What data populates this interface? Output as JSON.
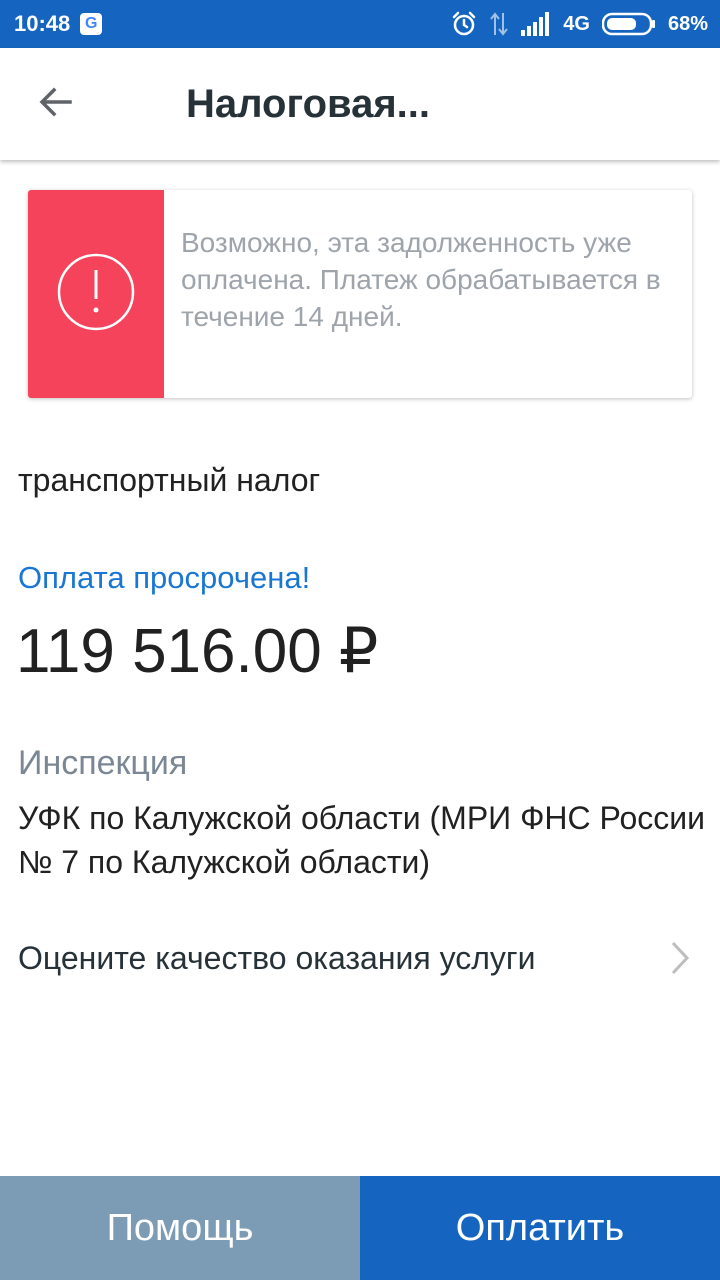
{
  "status_bar": {
    "time": "10:48",
    "google_badge": "G",
    "network": "4G",
    "battery": "68%",
    "icons": [
      "alarm-icon",
      "data-arrows-icon",
      "signal-icon",
      "battery-icon"
    ]
  },
  "header": {
    "title": "Налоговая...",
    "back_icon": "arrow-left-icon"
  },
  "warning": {
    "icon": "exclamation-circle-icon",
    "color": "#f5435c",
    "text": "Возможно, эта задолженность уже оплачена. Платеж обрабатывается в течение 14 дней."
  },
  "tax": {
    "type": "транспортный налог",
    "status": "Оплата просрочена!",
    "status_color": "#1976d2",
    "amount": "119 516.00 ₽"
  },
  "inspection": {
    "label": "Инспекция",
    "value": "УФК по Калужской области (МРИ ФНС России № 7 по Калужской области)"
  },
  "rating": {
    "label": "Оцените качество оказания услуги",
    "icon": "chevron-right-icon"
  },
  "buttons": {
    "help": "Помощь",
    "pay": "Оплатить",
    "help_color": "#7c9bb4",
    "pay_color": "#1565c0"
  }
}
